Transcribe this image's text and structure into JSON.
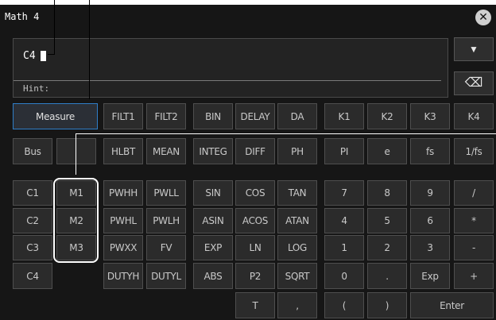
{
  "window": {
    "title": "Math 4",
    "close_glyph": "✕"
  },
  "input": {
    "expression": "C4",
    "hint_label": "Hint:"
  },
  "side_buttons": [
    {
      "name": "dropdown-button",
      "icon": "chevron-down-icon",
      "glyph": "▼"
    },
    {
      "name": "backspace-button",
      "icon": "backspace-icon",
      "glyph": "⌫"
    }
  ],
  "keys": {
    "row1": [
      "Measure",
      "FILT1",
      "FILT2",
      "BIN",
      "DELAY",
      "DA",
      "K1",
      "K2",
      "K3",
      "K4"
    ],
    "row2": [
      "Bus",
      "",
      "HLBT",
      "MEAN",
      "INTEG",
      "DIFF",
      "PH",
      "PI",
      "e",
      "fs",
      "1/fs"
    ],
    "row3": [
      "C1",
      "M1",
      "PWHH",
      "PWLL",
      "SIN",
      "COS",
      "TAN",
      "7",
      "8",
      "9",
      "/"
    ],
    "row4": [
      "C2",
      "M2",
      "PWHL",
      "PWLH",
      "ASIN",
      "ACOS",
      "ATAN",
      "4",
      "5",
      "6",
      "*"
    ],
    "row5": [
      "C3",
      "M3",
      "PWXX",
      "FV",
      "EXP",
      "LN",
      "LOG",
      "1",
      "2",
      "3",
      "-"
    ],
    "row6": [
      "C4",
      "",
      "DUTYH",
      "DUTYL",
      "ABS",
      "P2",
      "SQRT",
      "0",
      ".",
      "Exp",
      "+"
    ],
    "row7": [
      "T",
      ",",
      "(",
      ")",
      "Enter"
    ]
  },
  "colors": {
    "panel": "#161616",
    "key": "#2b2b2b",
    "selected_border": "#2f7ec8",
    "text": "#c9c9c9"
  }
}
